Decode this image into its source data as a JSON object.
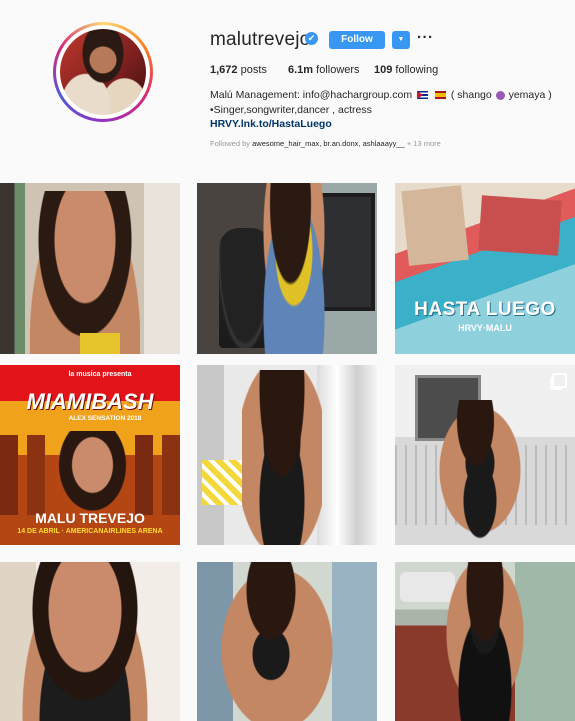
{
  "profile": {
    "username": "malutrevejo",
    "verified_icon": "✔",
    "follow_label": "Follow",
    "dropdown_icon": "▼",
    "more_icon": "···",
    "stats": {
      "posts_count": "1,672",
      "posts_label": "posts",
      "followers_count": "6.1m",
      "followers_label": "followers",
      "following_count": "109",
      "following_label": "following"
    },
    "bio": {
      "line1_prefix": "Malú Management: info@hachargroup.com",
      "line1_suffix_a": "( shango",
      "line1_suffix_b": "yemaya )",
      "line2": "•Singer,songwriter,dancer , actress",
      "link": "HRVY.lnk.to/HastaLuego"
    },
    "followed_by": {
      "prefix": "Followed by",
      "names": "awesome_hair_max, br.an.donx, ashlaaayy__",
      "more": "+ 13 more"
    }
  },
  "grid": {
    "posts": [
      {
        "id": "post-1",
        "overlay": ""
      },
      {
        "id": "post-2",
        "overlay": ""
      },
      {
        "id": "post-3",
        "overlay": "HASTA LUEGO",
        "overlay2": "HRVY·MALU"
      },
      {
        "id": "post-4",
        "overlay": "MIAMIBASH",
        "overlay_sub": "la musica presenta",
        "overlay_top": "ALEX SENSATION 2018",
        "overlay_name": "MALU TREVEJO",
        "overlay_date": "14 DE ABRIL · AMERICANAIRLINES ARENA"
      },
      {
        "id": "post-5",
        "overlay": ""
      },
      {
        "id": "post-6",
        "overlay": ""
      },
      {
        "id": "post-7",
        "overlay": ""
      },
      {
        "id": "post-8",
        "overlay": ""
      },
      {
        "id": "post-9",
        "overlay": ""
      }
    ]
  },
  "colors": {
    "accent": "#3897f0",
    "link": "#003569",
    "text": "#262626",
    "muted": "#999999"
  }
}
